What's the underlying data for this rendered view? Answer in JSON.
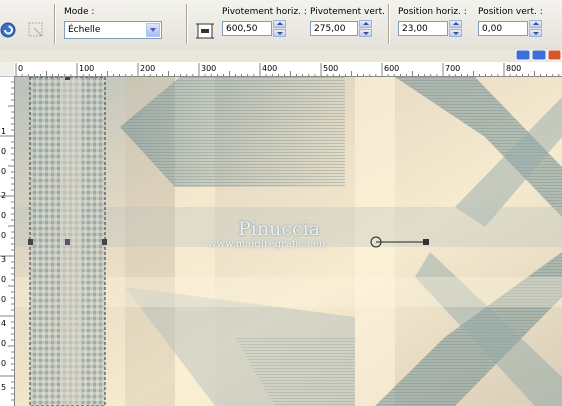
{
  "toolbar": {
    "mode_label": "Mode :",
    "mode_value": "Échelle",
    "pivot_h_label": "Pivotement horiz. :",
    "pivot_h_value": "600,50",
    "pivot_v_label": "Pivotement vert. :",
    "pivot_v_value": "275,00",
    "pos_h_label": "Position horiz. :",
    "pos_h_value": "23,00",
    "pos_v_label": "Position vert. :",
    "pos_v_value": "0,00"
  },
  "ruler_top": {
    "ticks": [
      "0",
      "100",
      "200",
      "300",
      "400",
      "500",
      "600",
      "700",
      "800"
    ]
  },
  "ruler_left": {
    "ticks": [
      "1",
      "0",
      "0",
      "2",
      "0",
      "0",
      "3",
      "0",
      "0",
      "4",
      "0",
      "0",
      "5"
    ]
  },
  "watermark": {
    "title": "Pinuccia",
    "url": "www.maidiregrafica.eu"
  },
  "colors": {
    "canvas_base": "#e9ddc8",
    "teal": "#8ea7a8",
    "cream": "#f5e9c9"
  }
}
